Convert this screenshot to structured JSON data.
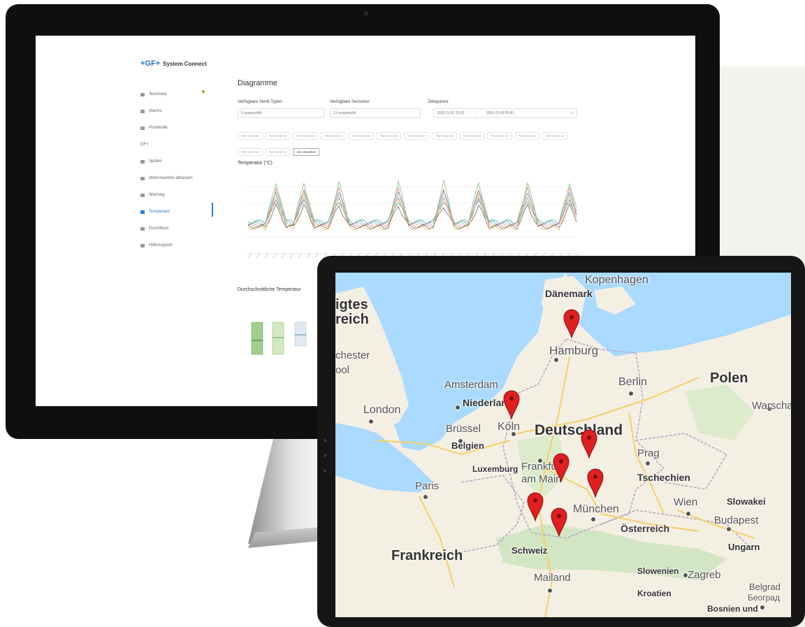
{
  "dashboard": {
    "logo": "+GF+",
    "product": "System Connect",
    "sidebar": [
      {
        "label": "Summary",
        "icon": "grid-icon"
      },
      {
        "label": "Alarms",
        "icon": "bell-icon"
      },
      {
        "label": "Protokolle",
        "icon": "list-icon"
      },
      {
        "label": "GF+",
        "icon": ""
      },
      {
        "label": "Spülen",
        "icon": "drop-icon"
      },
      {
        "label": "Wohnraumlos ablassen",
        "icon": "valve-icon"
      },
      {
        "label": "Wartung",
        "icon": "wrench-icon"
      },
      {
        "label": "Temperatur",
        "icon": "thermometer-icon"
      },
      {
        "label": "Durchfluss",
        "icon": "flow-icon"
      },
      {
        "label": "Hilfe/support",
        "icon": "help-icon"
      }
    ],
    "page_title": "Diagramme",
    "filters": {
      "valve_label": "Verfügbare Ventil Typen",
      "valve_value": "5 ausgewählt",
      "sensor_label": "Verfügbare Sensoren",
      "sensor_value": "13 ausgewählt",
      "period_label": "Zeitspanne",
      "period_from": "2020-11-02 21:00",
      "period_to": "2020-11-09 00:00"
    },
    "chips": [
      "TW-Ventil 01",
      "TW-Ventil 02",
      "TW-Ventil 03",
      "TW-Ventil 04",
      "TW-Ventil 05",
      "TW-Ventil 06",
      "TW-Ventil 07",
      "TW-Ventil 08",
      "TW-Ventil 09",
      "TW-Ventil 10",
      "TW-Ventil 11",
      "TW-Ventil 12",
      "TW-Ventil 13",
      "TW-Ventil 14"
    ],
    "select_all": "Alle abwählen",
    "chart1_title": "Temperatur (°C)",
    "chart2_title": "Durchschnittliche Temperatur"
  },
  "map": {
    "labels": [
      {
        "text": "Kopenhagen",
        "cls": "n",
        "size": 16
      },
      {
        "text": "Dänemark",
        "cls": "",
        "size": 14
      },
      {
        "text": "Hamburg",
        "cls": "n",
        "size": 17
      },
      {
        "text": "Berlin",
        "cls": "n",
        "size": 16
      },
      {
        "text": "Polen",
        "cls": "",
        "size": 20
      },
      {
        "text": "Warschau",
        "cls": "n",
        "size": 15
      },
      {
        "text": "igtes",
        "cls": "",
        "size": 20
      },
      {
        "text": "reich",
        "cls": "",
        "size": 20
      },
      {
        "text": "chester",
        "cls": "n",
        "size": 15
      },
      {
        "text": "ool",
        "cls": "n",
        "size": 15
      },
      {
        "text": "Amsterdam",
        "cls": "n",
        "size": 15
      },
      {
        "text": "Niederlande",
        "cls": "",
        "size": 14
      },
      {
        "text": "London",
        "cls": "n",
        "size": 16
      },
      {
        "text": "Brüssel",
        "cls": "n",
        "size": 15
      },
      {
        "text": "Belgien",
        "cls": "",
        "size": 13
      },
      {
        "text": "Köln",
        "cls": "n",
        "size": 16
      },
      {
        "text": "Deutschland",
        "cls": "",
        "size": 21
      },
      {
        "text": "Prag",
        "cls": "n",
        "size": 15
      },
      {
        "text": "Luxemburg",
        "cls": "",
        "size": 12
      },
      {
        "text": "Frankfurt",
        "cls": "n",
        "size": 15
      },
      {
        "text": "am Main",
        "cls": "n",
        "size": 15
      },
      {
        "text": "Tschechien",
        "cls": "",
        "size": 14
      },
      {
        "text": "Paris",
        "cls": "n",
        "size": 15
      },
      {
        "text": "München",
        "cls": "n",
        "size": 16
      },
      {
        "text": "Wien",
        "cls": "n",
        "size": 15
      },
      {
        "text": "Slowakei",
        "cls": "",
        "size": 13
      },
      {
        "text": "Budapest",
        "cls": "n",
        "size": 15
      },
      {
        "text": "Österreich",
        "cls": "",
        "size": 14
      },
      {
        "text": "Ungarn",
        "cls": "",
        "size": 13
      },
      {
        "text": "Frankreich",
        "cls": "",
        "size": 20
      },
      {
        "text": "Schweiz",
        "cls": "",
        "size": 13
      },
      {
        "text": "Slowenien",
        "cls": "",
        "size": 12
      },
      {
        "text": "Zagreb",
        "cls": "n",
        "size": 15
      },
      {
        "text": "Mailand",
        "cls": "n",
        "size": 15
      },
      {
        "text": "Kroatien",
        "cls": "",
        "size": 12
      },
      {
        "text": "Belgrad",
        "cls": "n",
        "size": 13
      },
      {
        "text": "Београд",
        "cls": "n",
        "size": 12
      },
      {
        "text": "Bosnien und",
        "cls": "",
        "size": 12
      }
    ],
    "pins": [
      {
        "name": "Hamburg"
      },
      {
        "name": "Köln"
      },
      {
        "name": "Thüringen"
      },
      {
        "name": "Würzburg"
      },
      {
        "name": "München"
      },
      {
        "name": "Freiburg"
      },
      {
        "name": "Bodensee"
      }
    ]
  }
}
